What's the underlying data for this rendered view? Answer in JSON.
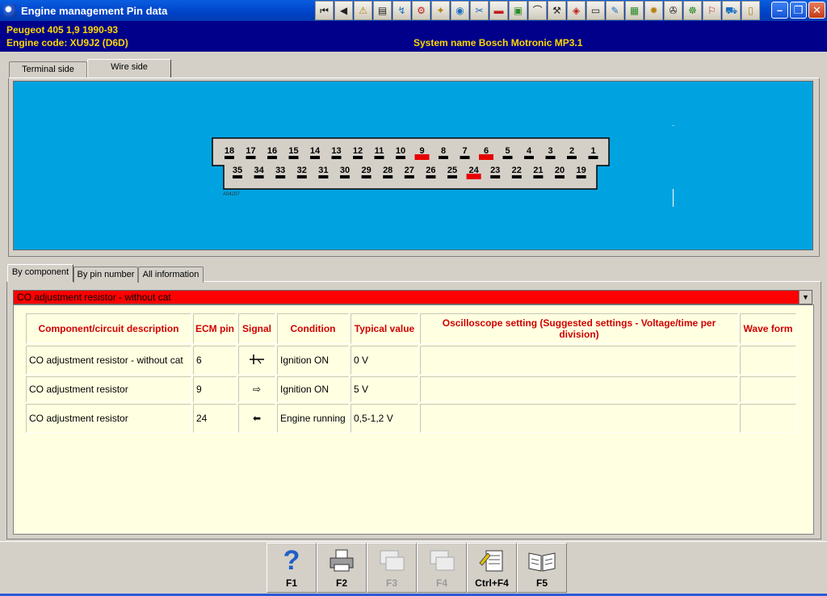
{
  "window": {
    "title": "Engine management Pin data"
  },
  "vehicle": {
    "model_line": "Peugeot  405  1,9  1990-93",
    "engine_code": "Engine code: XU9J2 (D6D)",
    "system_name": "System name Bosch Motronic MP3.1"
  },
  "diagram_tabs": [
    {
      "label": "Terminal side",
      "active": false
    },
    {
      "label": "Wire side",
      "active": true
    }
  ],
  "connector": {
    "top_row": [
      "18",
      "17",
      "16",
      "15",
      "14",
      "13",
      "12",
      "11",
      "10",
      "9",
      "8",
      "7",
      "6",
      "5",
      "4",
      "3",
      "2",
      "1"
    ],
    "bottom_row": [
      "35",
      "34",
      "33",
      "32",
      "31",
      "30",
      "29",
      "28",
      "27",
      "26",
      "25",
      "24",
      "23",
      "22",
      "21",
      "20",
      "19"
    ],
    "highlighted_pins": [
      "9",
      "6",
      "24"
    ],
    "ref_code": "A04207",
    "colors": {
      "background": "#00a3e0",
      "highlight": "#e60000",
      "pin": "#000000"
    }
  },
  "info_tabs": [
    {
      "label": "By component",
      "active": true
    },
    {
      "label": "By pin number",
      "active": false
    },
    {
      "label": "All information",
      "active": false
    }
  ],
  "component_select": {
    "value": "CO adjustment resistor - without cat"
  },
  "table": {
    "headers": {
      "description": "Component/circuit description",
      "ecm_pin": "ECM pin",
      "signal": "Signal",
      "condition": "Condition",
      "typical": "Typical value",
      "scope": "Oscilloscope setting (Suggested settings - Voltage/time per division)",
      "wave": "Wave form"
    },
    "rows": [
      {
        "description": "CO adjustment resistor - without cat",
        "pin": "6",
        "signal": "ground-icon",
        "condition": "Ignition ON",
        "value": "0 V",
        "scope": "",
        "wave": ""
      },
      {
        "description": "CO adjustment resistor",
        "pin": "9",
        "signal": "output-arrow-icon",
        "condition": "Ignition ON",
        "value": "5 V",
        "scope": "",
        "wave": ""
      },
      {
        "description": "CO adjustment resistor",
        "pin": "24",
        "signal": "input-arrow-icon",
        "condition": "Engine running",
        "value": "0,5-1,2 V",
        "scope": "",
        "wave": ""
      }
    ]
  },
  "function_keys": [
    {
      "label": "F1",
      "icon": "help-icon",
      "enabled": true
    },
    {
      "label": "F2",
      "icon": "printer-icon",
      "enabled": true
    },
    {
      "label": "F3",
      "icon": "image-icon",
      "enabled": false
    },
    {
      "label": "F4",
      "icon": "image-icon",
      "enabled": false
    },
    {
      "label": "Ctrl+F4",
      "icon": "notes-icon",
      "enabled": true
    },
    {
      "label": "F5",
      "icon": "book-icon",
      "enabled": true
    }
  ]
}
